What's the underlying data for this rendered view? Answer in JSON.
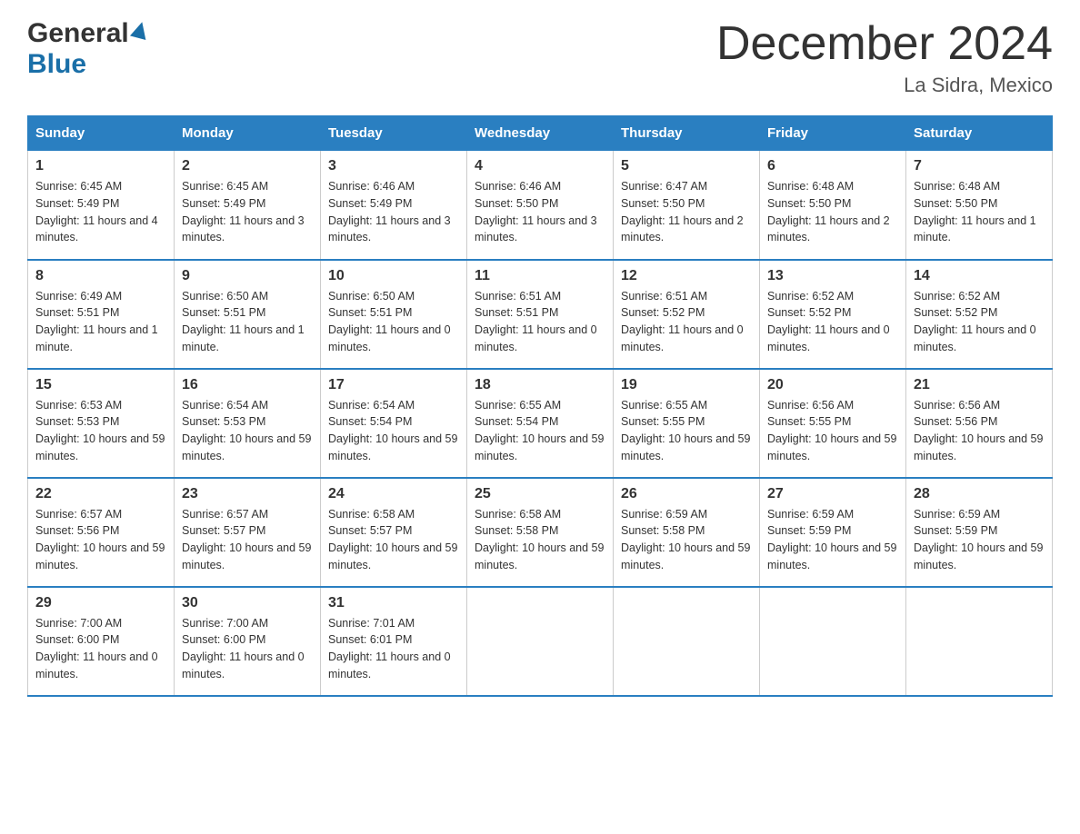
{
  "header": {
    "logo_general": "General",
    "logo_blue": "Blue",
    "month_title": "December 2024",
    "location": "La Sidra, Mexico"
  },
  "days_of_week": [
    "Sunday",
    "Monday",
    "Tuesday",
    "Wednesday",
    "Thursday",
    "Friday",
    "Saturday"
  ],
  "weeks": [
    [
      {
        "day": "1",
        "sunrise": "6:45 AM",
        "sunset": "5:49 PM",
        "daylight": "11 hours and 4 minutes."
      },
      {
        "day": "2",
        "sunrise": "6:45 AM",
        "sunset": "5:49 PM",
        "daylight": "11 hours and 3 minutes."
      },
      {
        "day": "3",
        "sunrise": "6:46 AM",
        "sunset": "5:49 PM",
        "daylight": "11 hours and 3 minutes."
      },
      {
        "day": "4",
        "sunrise": "6:46 AM",
        "sunset": "5:50 PM",
        "daylight": "11 hours and 3 minutes."
      },
      {
        "day": "5",
        "sunrise": "6:47 AM",
        "sunset": "5:50 PM",
        "daylight": "11 hours and 2 minutes."
      },
      {
        "day": "6",
        "sunrise": "6:48 AM",
        "sunset": "5:50 PM",
        "daylight": "11 hours and 2 minutes."
      },
      {
        "day": "7",
        "sunrise": "6:48 AM",
        "sunset": "5:50 PM",
        "daylight": "11 hours and 1 minute."
      }
    ],
    [
      {
        "day": "8",
        "sunrise": "6:49 AM",
        "sunset": "5:51 PM",
        "daylight": "11 hours and 1 minute."
      },
      {
        "day": "9",
        "sunrise": "6:50 AM",
        "sunset": "5:51 PM",
        "daylight": "11 hours and 1 minute."
      },
      {
        "day": "10",
        "sunrise": "6:50 AM",
        "sunset": "5:51 PM",
        "daylight": "11 hours and 0 minutes."
      },
      {
        "day": "11",
        "sunrise": "6:51 AM",
        "sunset": "5:51 PM",
        "daylight": "11 hours and 0 minutes."
      },
      {
        "day": "12",
        "sunrise": "6:51 AM",
        "sunset": "5:52 PM",
        "daylight": "11 hours and 0 minutes."
      },
      {
        "day": "13",
        "sunrise": "6:52 AM",
        "sunset": "5:52 PM",
        "daylight": "11 hours and 0 minutes."
      },
      {
        "day": "14",
        "sunrise": "6:52 AM",
        "sunset": "5:52 PM",
        "daylight": "11 hours and 0 minutes."
      }
    ],
    [
      {
        "day": "15",
        "sunrise": "6:53 AM",
        "sunset": "5:53 PM",
        "daylight": "10 hours and 59 minutes."
      },
      {
        "day": "16",
        "sunrise": "6:54 AM",
        "sunset": "5:53 PM",
        "daylight": "10 hours and 59 minutes."
      },
      {
        "day": "17",
        "sunrise": "6:54 AM",
        "sunset": "5:54 PM",
        "daylight": "10 hours and 59 minutes."
      },
      {
        "day": "18",
        "sunrise": "6:55 AM",
        "sunset": "5:54 PM",
        "daylight": "10 hours and 59 minutes."
      },
      {
        "day": "19",
        "sunrise": "6:55 AM",
        "sunset": "5:55 PM",
        "daylight": "10 hours and 59 minutes."
      },
      {
        "day": "20",
        "sunrise": "6:56 AM",
        "sunset": "5:55 PM",
        "daylight": "10 hours and 59 minutes."
      },
      {
        "day": "21",
        "sunrise": "6:56 AM",
        "sunset": "5:56 PM",
        "daylight": "10 hours and 59 minutes."
      }
    ],
    [
      {
        "day": "22",
        "sunrise": "6:57 AM",
        "sunset": "5:56 PM",
        "daylight": "10 hours and 59 minutes."
      },
      {
        "day": "23",
        "sunrise": "6:57 AM",
        "sunset": "5:57 PM",
        "daylight": "10 hours and 59 minutes."
      },
      {
        "day": "24",
        "sunrise": "6:58 AM",
        "sunset": "5:57 PM",
        "daylight": "10 hours and 59 minutes."
      },
      {
        "day": "25",
        "sunrise": "6:58 AM",
        "sunset": "5:58 PM",
        "daylight": "10 hours and 59 minutes."
      },
      {
        "day": "26",
        "sunrise": "6:59 AM",
        "sunset": "5:58 PM",
        "daylight": "10 hours and 59 minutes."
      },
      {
        "day": "27",
        "sunrise": "6:59 AM",
        "sunset": "5:59 PM",
        "daylight": "10 hours and 59 minutes."
      },
      {
        "day": "28",
        "sunrise": "6:59 AM",
        "sunset": "5:59 PM",
        "daylight": "10 hours and 59 minutes."
      }
    ],
    [
      {
        "day": "29",
        "sunrise": "7:00 AM",
        "sunset": "6:00 PM",
        "daylight": "11 hours and 0 minutes."
      },
      {
        "day": "30",
        "sunrise": "7:00 AM",
        "sunset": "6:00 PM",
        "daylight": "11 hours and 0 minutes."
      },
      {
        "day": "31",
        "sunrise": "7:01 AM",
        "sunset": "6:01 PM",
        "daylight": "11 hours and 0 minutes."
      },
      null,
      null,
      null,
      null
    ]
  ],
  "labels": {
    "sunrise": "Sunrise:",
    "sunset": "Sunset:",
    "daylight": "Daylight:"
  }
}
